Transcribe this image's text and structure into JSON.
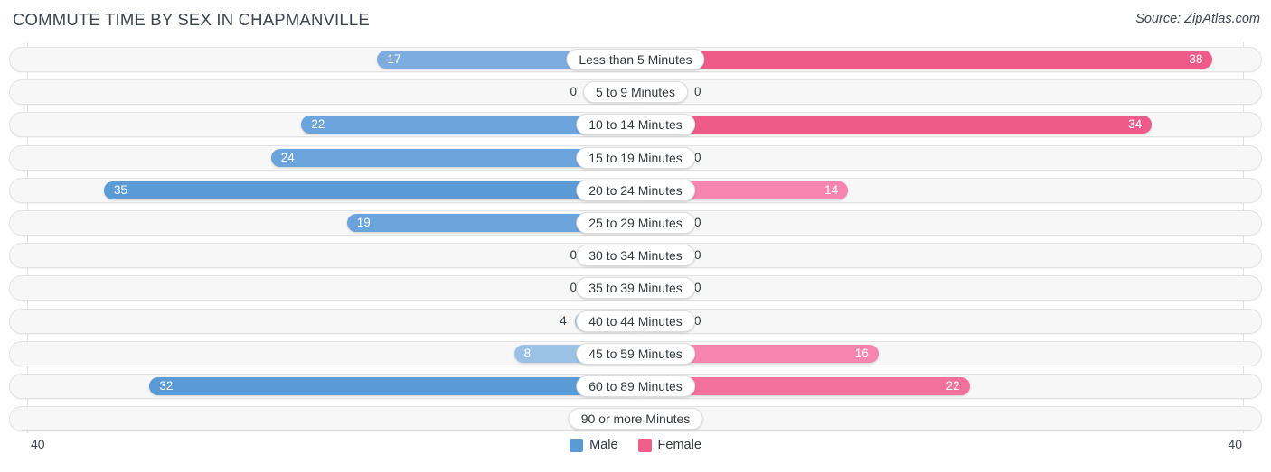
{
  "header": {
    "title": "COMMUTE TIME BY SEX IN CHAPMANVILLE",
    "source": "Source: ZipAtlas.com"
  },
  "legend": {
    "items": [
      {
        "label": "Male",
        "color": "#5b9bd5"
      },
      {
        "label": "Female",
        "color": "#ef5f8a"
      }
    ]
  },
  "axis": {
    "left_tick": "40",
    "right_tick": "40"
  },
  "chart_data": {
    "type": "bar",
    "subtype": "diverging-horizontal-bar",
    "title": "COMMUTE TIME BY SEX IN CHAPMANVILLE",
    "xlabel": "",
    "ylabel": "",
    "xlim": [
      -40,
      40
    ],
    "axis_max": 40,
    "grid": false,
    "legend_position": "bottom-center",
    "categories": [
      "Less than 5 Minutes",
      "5 to 9 Minutes",
      "10 to 14 Minutes",
      "15 to 19 Minutes",
      "20 to 24 Minutes",
      "25 to 29 Minutes",
      "30 to 34 Minutes",
      "35 to 39 Minutes",
      "40 to 44 Minutes",
      "45 to 59 Minutes",
      "60 to 89 Minutes",
      "90 or more Minutes"
    ],
    "series": [
      {
        "name": "Male",
        "direction": "left",
        "values": [
          17,
          0,
          22,
          24,
          35,
          19,
          0,
          0,
          4,
          8,
          32,
          0
        ]
      },
      {
        "name": "Female",
        "direction": "right",
        "values": [
          38,
          0,
          34,
          0,
          14,
          0,
          0,
          0,
          0,
          16,
          22,
          0
        ]
      }
    ]
  },
  "rows": [
    {
      "label": "Less than 5 Minutes",
      "male": "17",
      "female": "38",
      "male_val": 17,
      "female_val": 38
    },
    {
      "label": "5 to 9 Minutes",
      "male": "0",
      "female": "0",
      "male_val": 0,
      "female_val": 0
    },
    {
      "label": "10 to 14 Minutes",
      "male": "22",
      "female": "34",
      "male_val": 22,
      "female_val": 34
    },
    {
      "label": "15 to 19 Minutes",
      "male": "24",
      "female": "0",
      "male_val": 24,
      "female_val": 0
    },
    {
      "label": "20 to 24 Minutes",
      "male": "35",
      "female": "14",
      "male_val": 35,
      "female_val": 14
    },
    {
      "label": "25 to 29 Minutes",
      "male": "19",
      "female": "0",
      "male_val": 19,
      "female_val": 0
    },
    {
      "label": "30 to 34 Minutes",
      "male": "0",
      "female": "0",
      "male_val": 0,
      "female_val": 0
    },
    {
      "label": "35 to 39 Minutes",
      "male": "0",
      "female": "0",
      "male_val": 0,
      "female_val": 0
    },
    {
      "label": "40 to 44 Minutes",
      "male": "4",
      "female": "0",
      "male_val": 4,
      "female_val": 0
    },
    {
      "label": "45 to 59 Minutes",
      "male": "8",
      "female": "16",
      "male_val": 8,
      "female_val": 16
    },
    {
      "label": "60 to 89 Minutes",
      "male": "32",
      "female": "22",
      "male_val": 32,
      "female_val": 22
    },
    {
      "label": "90 or more Minutes",
      "male": "0",
      "female": "0",
      "male_val": 0,
      "female_val": 0
    }
  ]
}
